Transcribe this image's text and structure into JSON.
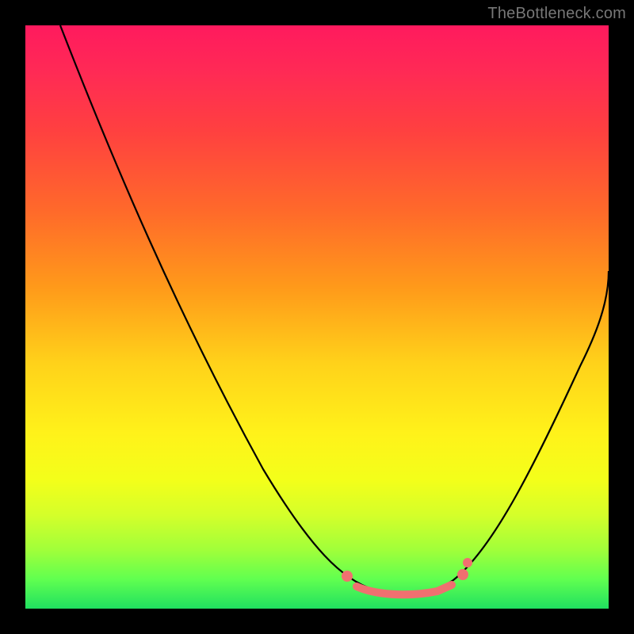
{
  "watermark": "TheBottleneck.com",
  "chart_data": {
    "type": "line",
    "title": "",
    "xlabel": "",
    "ylabel": "",
    "xlim": [
      0,
      100
    ],
    "ylim": [
      0,
      100
    ],
    "grid": false,
    "legend": false,
    "watermark": "TheBottleneck.com",
    "background": "rainbow-vertical",
    "series": [
      {
        "name": "bottleneck-curve",
        "x": [
          6,
          10,
          15,
          20,
          25,
          30,
          35,
          40,
          45,
          50,
          55,
          57,
          60,
          63,
          66,
          69,
          72,
          75,
          80,
          85,
          90,
          95,
          100
        ],
        "y": [
          100,
          92,
          83,
          74,
          65,
          56,
          47,
          38,
          29,
          20,
          11,
          8,
          4,
          2,
          1,
          1,
          2,
          4,
          12,
          22,
          33,
          45,
          58
        ]
      }
    ],
    "highlight": {
      "name": "optimal-range",
      "color": "#f07070",
      "left_dot_x": 55,
      "right_dot_x": 74,
      "flat_segment_x": [
        57,
        72
      ],
      "flat_segment_y": 1.5
    }
  }
}
